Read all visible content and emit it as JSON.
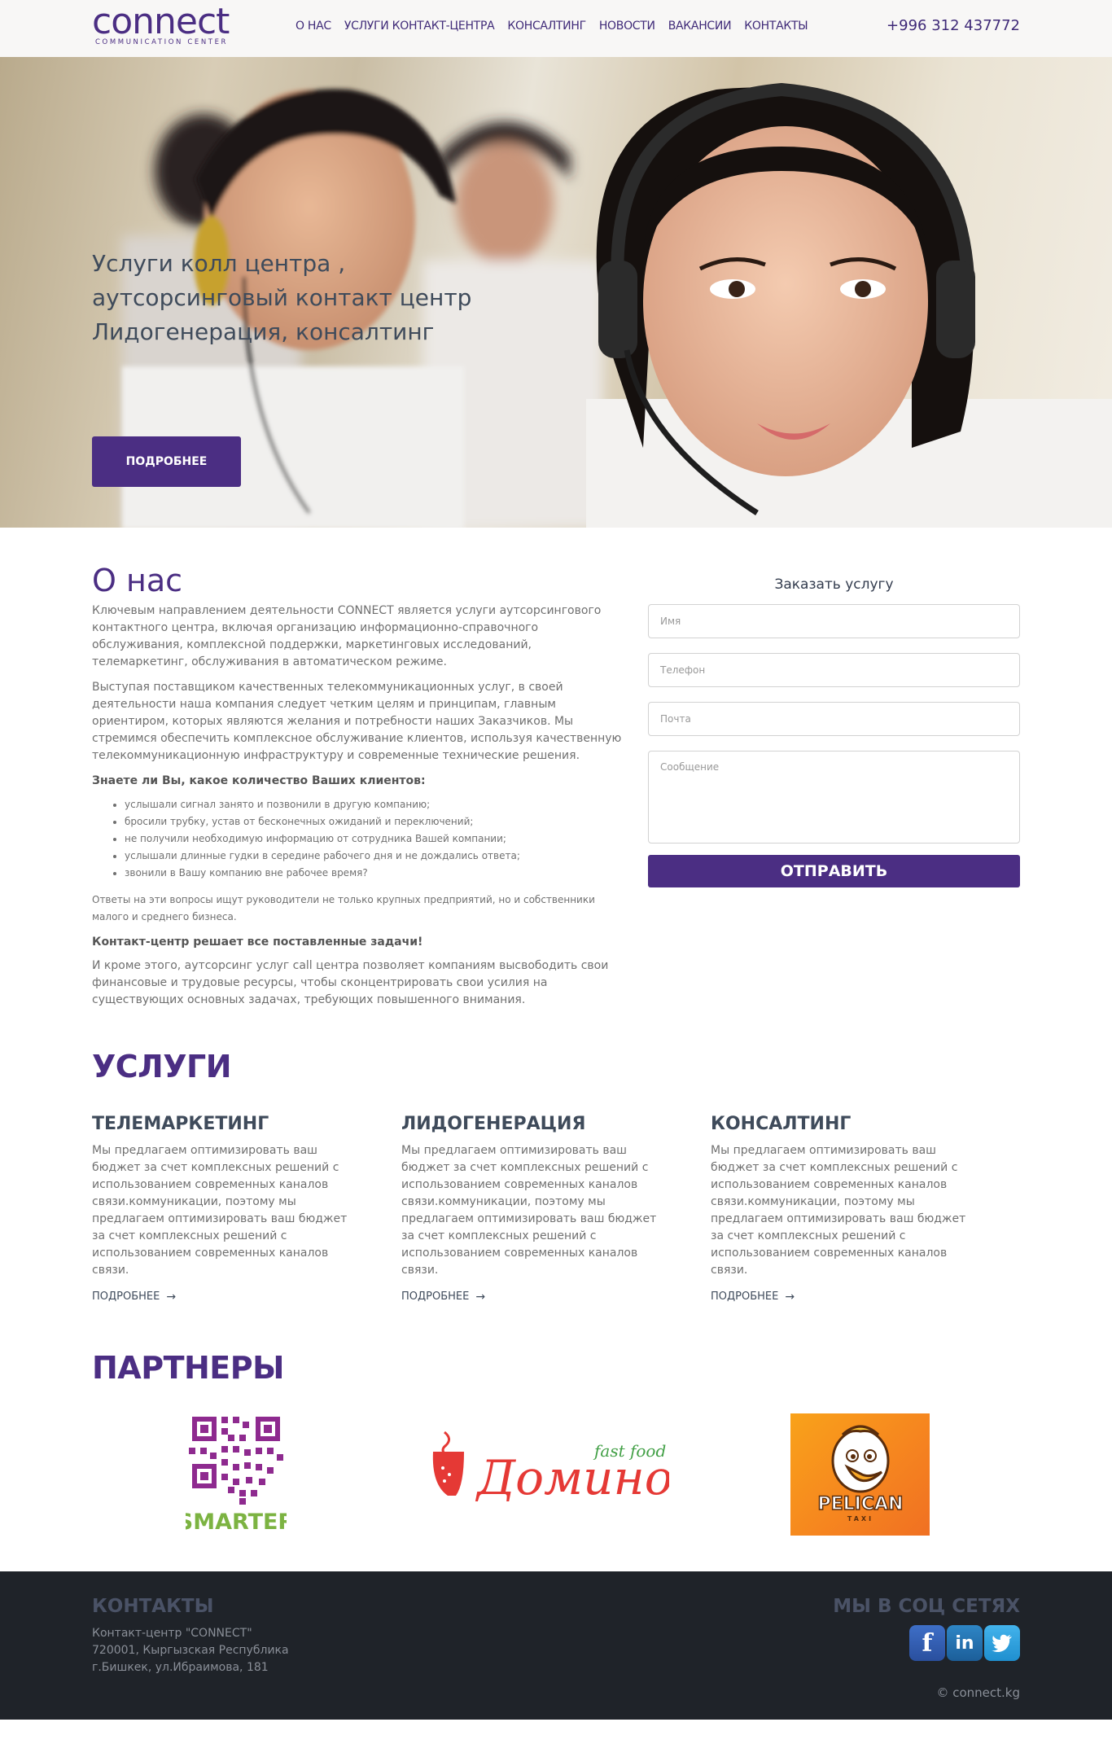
{
  "header": {
    "logo_text": "connect",
    "logo_subtitle": "COMMUNICATION CENTER",
    "nav": [
      {
        "label": "О НАС"
      },
      {
        "label": "УСЛУГИ КОНТАКТ-ЦЕНТРА"
      },
      {
        "label": "КОНСАЛТИНГ"
      },
      {
        "label": "НОВОСТИ"
      },
      {
        "label": "ВАКАНСИИ"
      },
      {
        "label": "КОНТАКТЫ"
      }
    ],
    "phone": "+996 312 437772"
  },
  "hero": {
    "title_lines": [
      "Услуги колл центра ,",
      "аутсорсинговый контакт центр",
      "Лидогенерация, консалтинг"
    ],
    "button_label": "ПОДРОБНЕЕ"
  },
  "about": {
    "title": "О нас",
    "p1": "Ключевым направлением деятельности CONNECT является услуги аутсорсингового контактного центра, включая организацию информационно-справочного обслуживания, комплексной поддержки, маркетинговых исследований, телемаркетинг, обслуживания в автоматическом режиме.",
    "p2": "Выступая поставщиком качественных телекоммуникационных услуг, в своей деятельности наша компания следует четким целям и принципам, главным ориентиром, которых являются желания и потребности наших Заказчиков. Мы стремимся обеспечить комплексное обслуживание клиентов, используя качественную телекоммуникационную инфраструктуру и современные технические решения.",
    "question": "Знаете ли Вы, какое количество Ваших клиентов:",
    "list": [
      "услышали сигнал занято и позвонили в другую компанию;",
      "бросили трубку, устав от бесконечных ожиданий и переключений;",
      "не получили необходимую информацию от сотрудника Вашей компании;",
      "услышали длинные гудки в середине рабочего дня и не дождались ответа;",
      "звонили в Вашу компанию вне рабочее время?"
    ],
    "p3": "Ответы на эти вопросы ищут руководители не только крупных предприятий, но и собственники малого и среднего бизнеса.",
    "tagline": "Контакт-центр решает все поставленные задачи!",
    "p4": "И кроме этого, аутсорсинг услуг call центра позволяет компаниям высвободить свои финансовые и трудовые ресурсы, чтобы сконцентрировать свои усилия на существующих основных задачах, требующих повышенного внимания."
  },
  "order_form": {
    "title": "Заказать услугу",
    "name_placeholder": "Имя",
    "phone_placeholder": "Телефон",
    "email_placeholder": "Почта",
    "message_placeholder": "Сообщение",
    "submit_label": "ОТПРАВИТЬ"
  },
  "services": {
    "title": "УСЛУГИ",
    "items": [
      {
        "title": "ТЕЛЕМАРКЕТИНГ",
        "text": "Мы предлагаем оптимизировать ваш бюджет за счет комплексных решений с использованием современных каналов связи.коммуникации, поэтому мы предлагаем оптимизировать ваш бюджет за счет комплексных решений с использованием современных каналов связи.",
        "more": "ПОДРОБНЕЕ"
      },
      {
        "title": "ЛИДОГЕНЕРАЦИЯ",
        "text": "Мы предлагаем оптимизировать ваш бюджет за счет комплексных решений с использованием современных каналов связи.коммуникации, поэтому мы предлагаем оптимизировать ваш бюджет за счет комплексных решений с использованием современных каналов связи.",
        "more": "ПОДРОБНЕЕ"
      },
      {
        "title": "КОНСАЛТИНГ",
        "text": "Мы предлагаем оптимизировать ваш бюджет за счет комплексных решений с использованием современных каналов связи.коммуникации, поэтому мы предлагаем оптимизировать ваш бюджет за счет комплексных решений с использованием современных каналов связи.",
        "more": "ПОДРОБНЕЕ"
      }
    ]
  },
  "partners": {
    "title": "ПАРТНЕРЫ",
    "logos": [
      {
        "name": "SMARTER"
      },
      {
        "name": "Домино",
        "tagline": "fast food"
      },
      {
        "name": "PELICAN",
        "subtitle": "TAXI"
      }
    ]
  },
  "footer": {
    "contacts_title": "КОНТАКТЫ",
    "address": [
      "Контакт-центр \"CONNECT\"",
      "720001, Кыргызская Республика",
      "г.Бишкек, ул.Ибраимова, 181"
    ],
    "social_title": "МЫ В СОЦ СЕТЯХ",
    "socials": [
      {
        "icon": "facebook-icon",
        "glyph": "f"
      },
      {
        "icon": "linkedin-icon",
        "glyph": "in"
      },
      {
        "icon": "twitter-icon",
        "glyph": "t"
      }
    ],
    "copyright": "© connect.kg"
  },
  "colors": {
    "brand": "#4b2e83",
    "heading": "#3f4b5b",
    "footer_bg": "#1f2329"
  }
}
